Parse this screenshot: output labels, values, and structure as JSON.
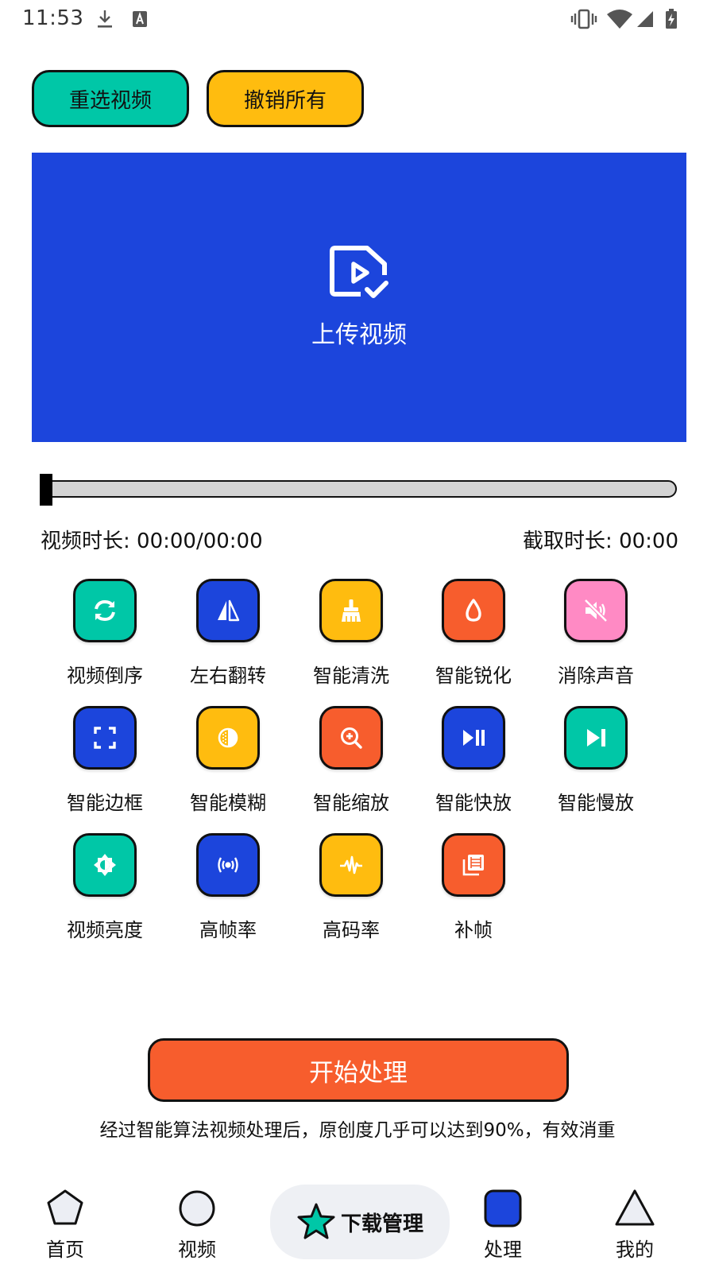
{
  "status_bar": {
    "time": "11:53",
    "left_icons": [
      "download-icon",
      "text-a-icon"
    ],
    "right_icons": [
      "vibrate-icon",
      "wifi-icon",
      "signal-icon",
      "battery-charging-icon"
    ]
  },
  "actions": {
    "reselect_label": "重选视频",
    "undo_label": "撤销所有"
  },
  "upload": {
    "label": "上传视频",
    "icon": "video-file-check-icon"
  },
  "progress": {
    "position": 0,
    "duration_text": "视频时长: 00:00/00:00",
    "clip_text": "截取时长: 00:00"
  },
  "tools": [
    {
      "label": "视频倒序",
      "icon": "refresh-icon",
      "color": "#00c7a7"
    },
    {
      "label": "左右翻转",
      "icon": "flip-icon",
      "color": "#1c45dc"
    },
    {
      "label": "智能清洗",
      "icon": "broom-icon",
      "color": "#ffbc0f"
    },
    {
      "label": "智能锐化",
      "icon": "drop-icon",
      "color": "#f75d2d"
    },
    {
      "label": "消除声音",
      "icon": "mute-icon",
      "color": "#ff8ac4"
    },
    {
      "label": "智能边框",
      "icon": "frame-corners-icon",
      "color": "#1c45dc"
    },
    {
      "label": "智能模糊",
      "icon": "blur-icon",
      "color": "#ffbc0f"
    },
    {
      "label": "智能缩放",
      "icon": "zoom-in-icon",
      "color": "#f75d2d"
    },
    {
      "label": "智能快放",
      "icon": "play-pause-icon",
      "color": "#1c45dc"
    },
    {
      "label": "智能慢放",
      "icon": "skip-next-icon",
      "color": "#00c7a7"
    },
    {
      "label": "视频亮度",
      "icon": "brightness-icon",
      "color": "#00c7a7"
    },
    {
      "label": "高帧率",
      "icon": "broadcast-icon",
      "color": "#1c45dc"
    },
    {
      "label": "高码率",
      "icon": "waveform-icon",
      "color": "#ffbc0f"
    },
    {
      "label": "补帧",
      "icon": "film-stack-icon",
      "color": "#f75d2d"
    }
  ],
  "start": {
    "label": "开始处理"
  },
  "footnote": "经过智能算法视频处理后，原创度几乎可以达到90%，有效消重",
  "bottom_nav": {
    "items": [
      {
        "label": "首页",
        "icon": "pentagon-icon"
      },
      {
        "label": "视频",
        "icon": "circle-icon"
      },
      {
        "label": "下载管理",
        "icon": "star-icon"
      },
      {
        "label": "处理",
        "icon": "square-icon"
      },
      {
        "label": "我的",
        "icon": "triangle-icon"
      }
    ]
  },
  "colors": {
    "teal": "#00c7a7",
    "yellow": "#ffbc0f",
    "blue": "#1c45dc",
    "orange": "#f75d2d",
    "pink": "#ff8ac4",
    "nav_shape_fill": "#eceef4"
  }
}
